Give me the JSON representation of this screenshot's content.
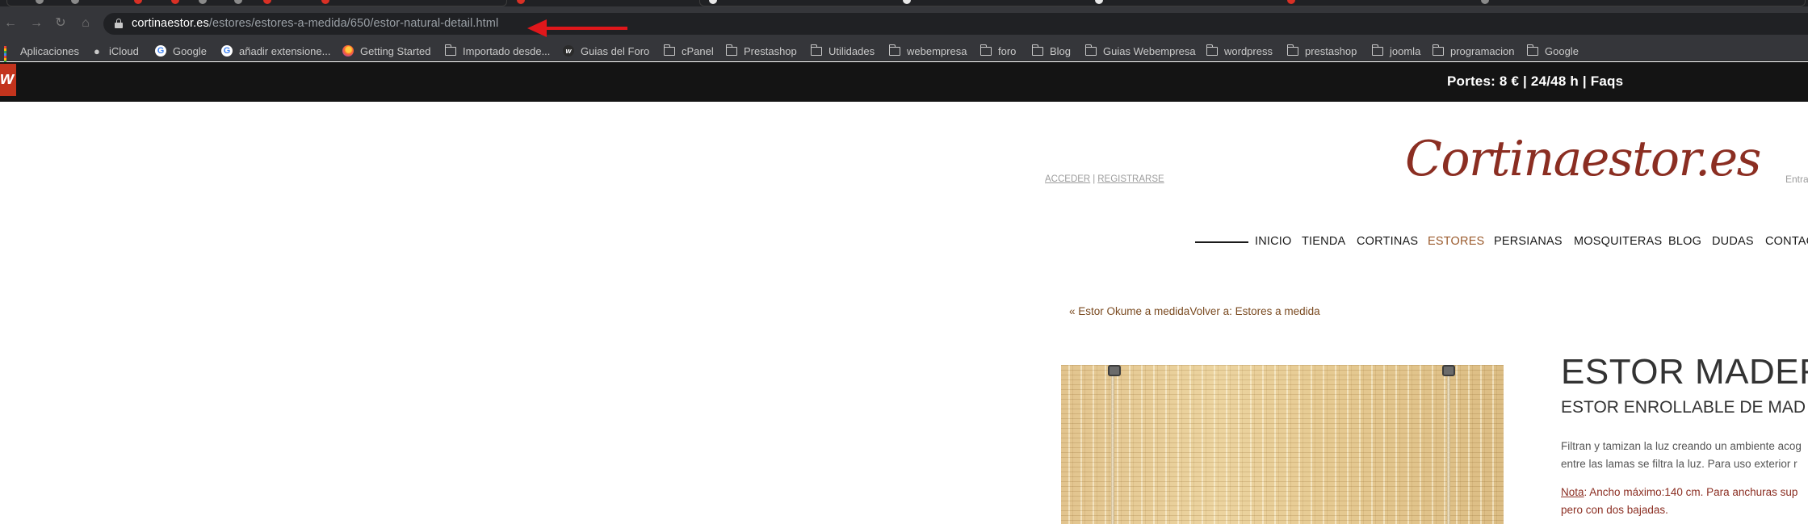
{
  "browser": {
    "url_host": "cortinaestor.es",
    "url_path": "/estores/estores-a-medida/650/estor-natural-detail.html",
    "bookmarks": [
      {
        "label": "Aplicaciones",
        "icon": "apps-grid-icon"
      },
      {
        "label": "iCloud",
        "icon": "apple-icon"
      },
      {
        "label": "Google",
        "icon": "google-icon"
      },
      {
        "label": "añadir extensione...",
        "icon": "google-icon"
      },
      {
        "label": "Getting Started",
        "icon": "firefox-icon"
      },
      {
        "label": "Importado desde...",
        "icon": "folder-icon"
      },
      {
        "label": "Guias del Foro",
        "icon": "webempresa-icon"
      },
      {
        "label": "cPanel",
        "icon": "folder-icon"
      },
      {
        "label": "Prestashop",
        "icon": "folder-icon"
      },
      {
        "label": "Utilidades",
        "icon": "folder-icon"
      },
      {
        "label": "webempresa",
        "icon": "folder-icon"
      },
      {
        "label": "foro",
        "icon": "folder-icon"
      },
      {
        "label": "Blog",
        "icon": "folder-icon"
      },
      {
        "label": "Guias Webempresa",
        "icon": "folder-icon"
      },
      {
        "label": "wordpress",
        "icon": "folder-icon"
      },
      {
        "label": "prestashop",
        "icon": "folder-icon"
      },
      {
        "label": "joomla",
        "icon": "folder-icon"
      },
      {
        "label": "programacion",
        "icon": "folder-icon"
      },
      {
        "label": "Google",
        "icon": "folder-icon"
      }
    ]
  },
  "site": {
    "badge_letter": "w",
    "shipping_text": "Portes: 8 € | 24/48 h | Faqs",
    "login_label": "ACCEDER",
    "auth_separator": "|",
    "register_label": "REGISTRARSE",
    "logo_text": "Cortinaestor.es",
    "entrar_partial": "Entra",
    "nav": [
      {
        "label": "INICIO",
        "active": false
      },
      {
        "label": "TIENDA",
        "active": false
      },
      {
        "label": "CORTINAS",
        "active": false
      },
      {
        "label": "ESTORES",
        "active": true
      },
      {
        "label": "PERSIANAS",
        "active": false
      },
      {
        "label": "MOSQUITERAS",
        "active": false
      },
      {
        "label": "BLOG",
        "active": false
      },
      {
        "label": "DUDAS",
        "active": false
      },
      {
        "label": "CONTAC",
        "active": false
      }
    ],
    "prev_link": "« Estor Okume a medida",
    "back_link": "Volver a: Estores a medida"
  },
  "product": {
    "title": "ESTOR MADER",
    "subtitle": "ESTOR ENROLLABLE DE MAD",
    "desc_line1": "Filtran y tamizan la luz creando un ambiente acog",
    "desc_line2": "entre las lamas se filtra la luz. Para uso exterior r",
    "note_label": "Nota",
    "note_line1_rest": ": Ancho máximo:140 cm. Para anchuras sup",
    "note_line2": "pero con dos bajadas."
  },
  "colors": {
    "chrome_dark": "#35363a",
    "site_topbar": "#141414",
    "brand_red": "#c3341d",
    "logo_color": "#8b2e22",
    "nav_active": "#9a5a2c",
    "annotation_arrow": "#e0171b"
  }
}
